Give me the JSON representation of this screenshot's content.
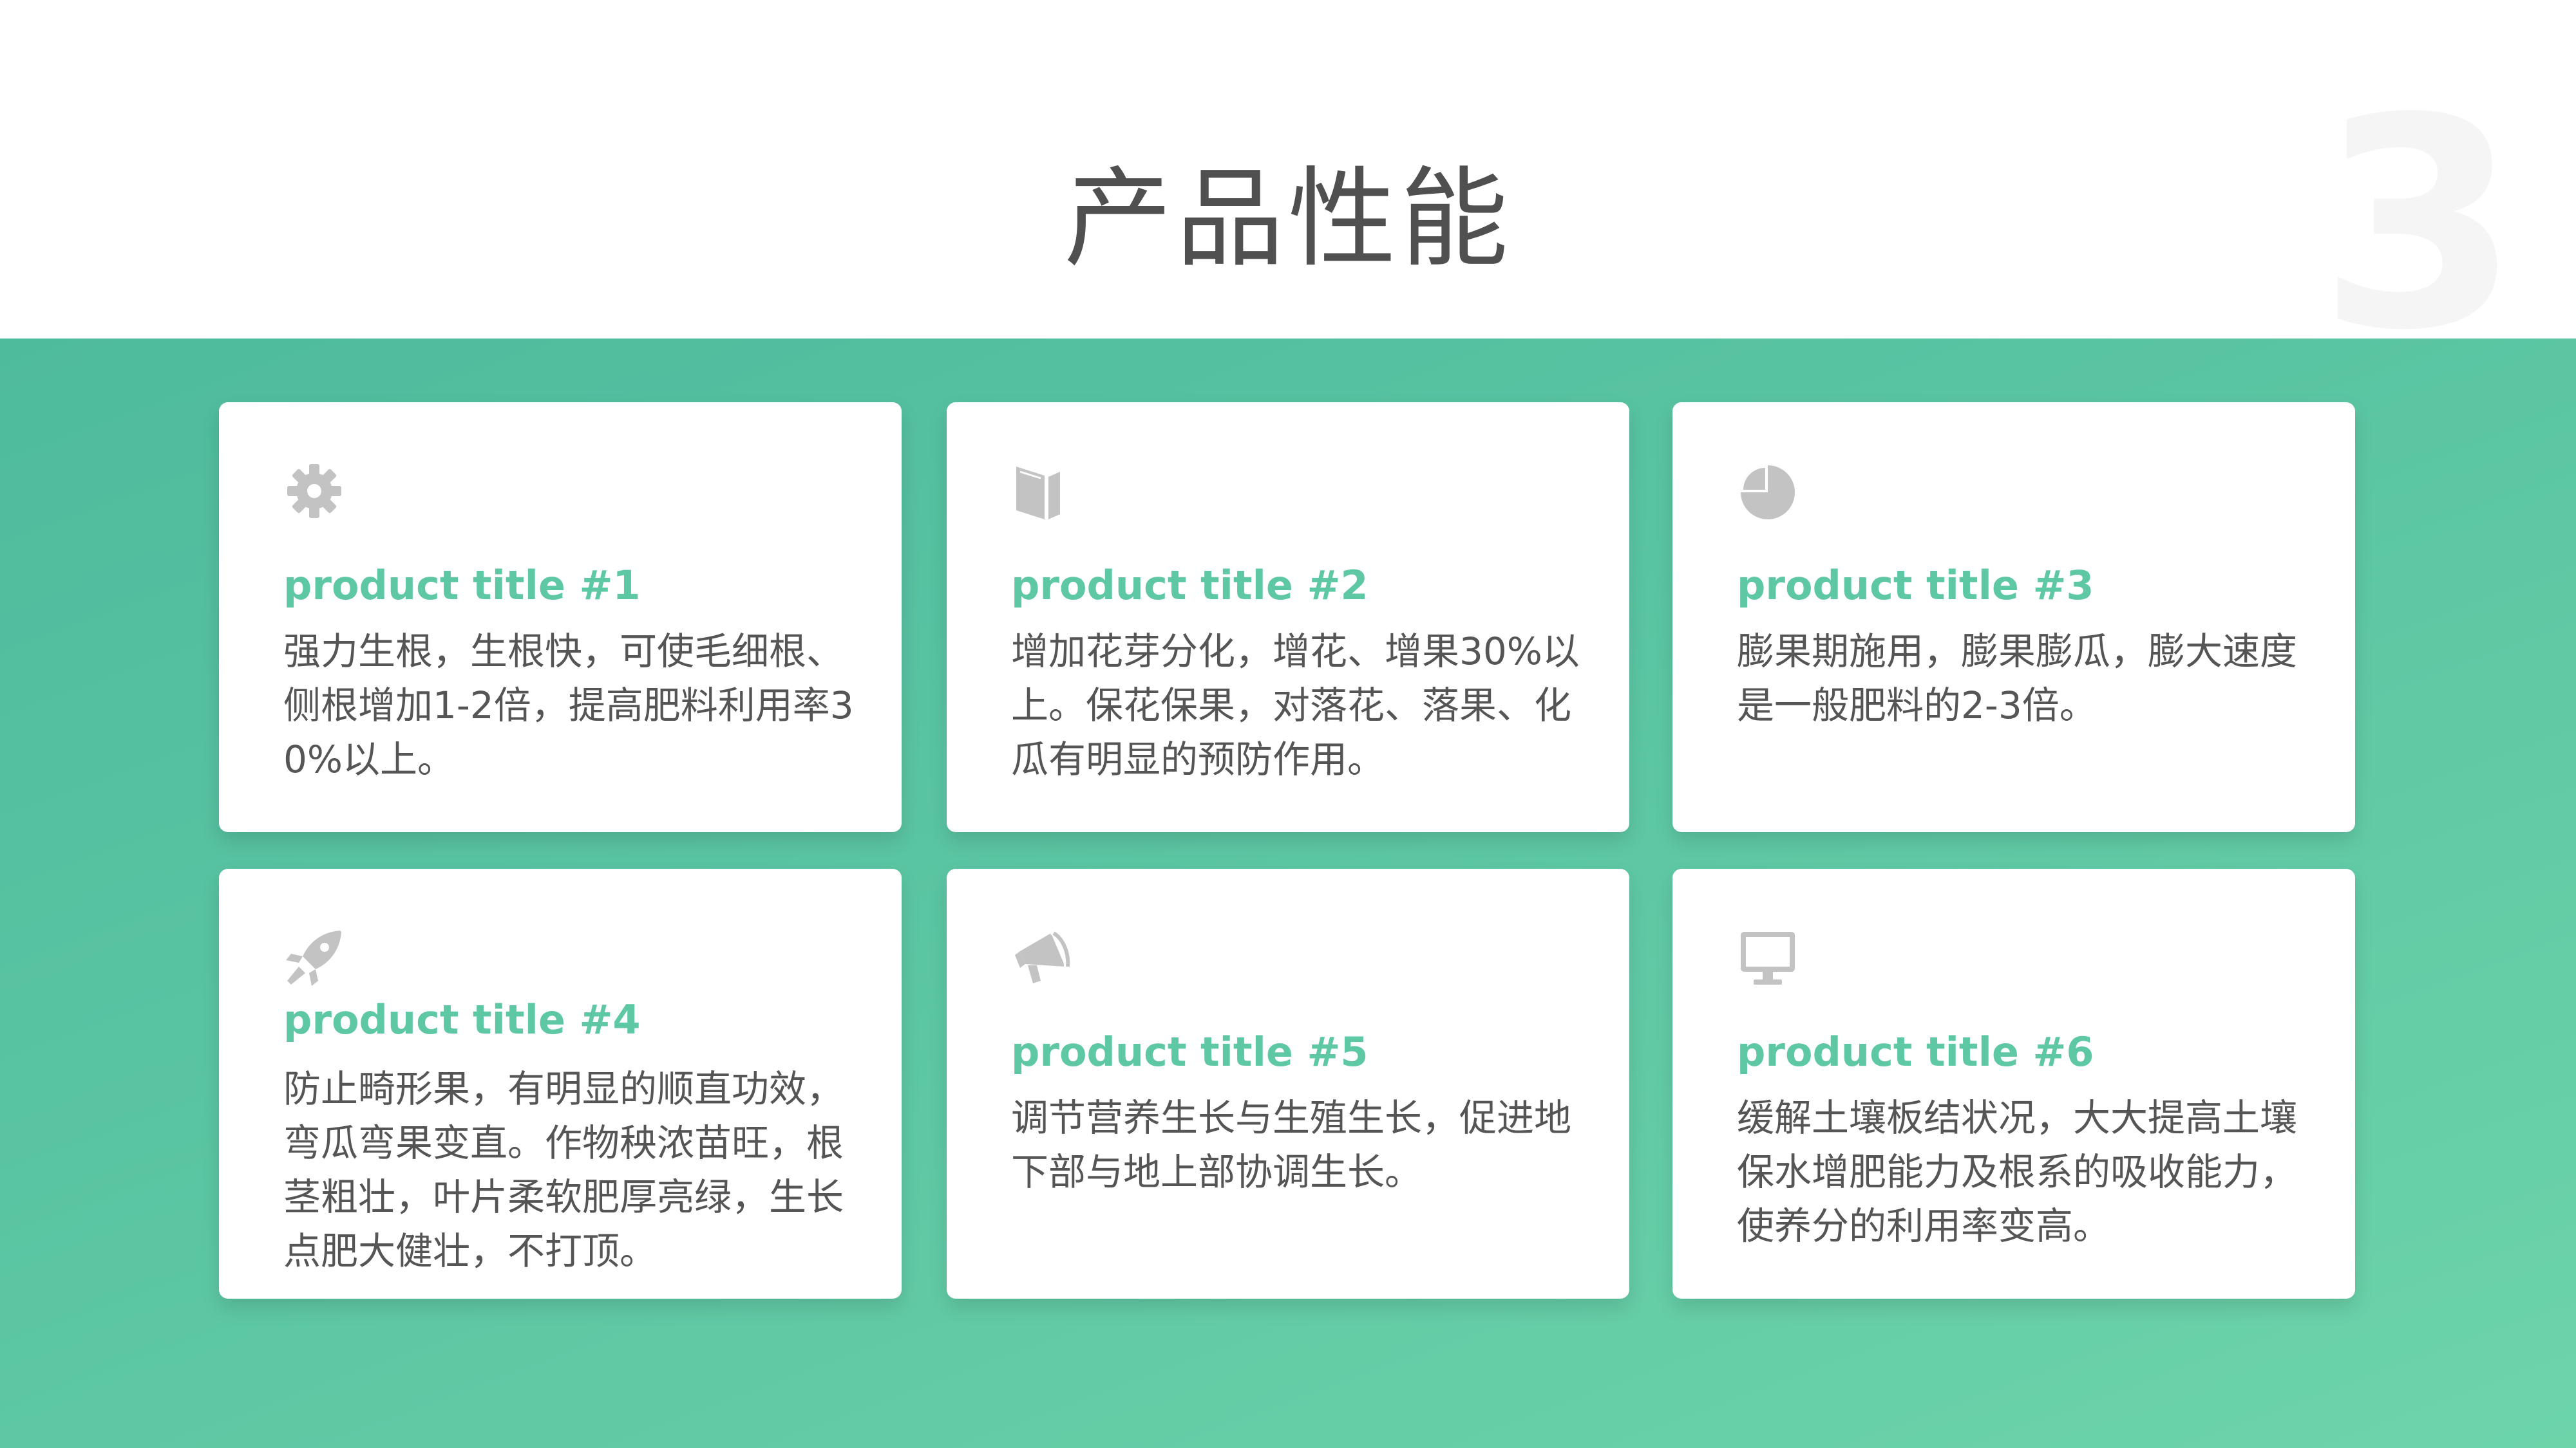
{
  "slide": {
    "title": "产品性能",
    "number": "3"
  },
  "colors": {
    "accent": "#5ec8a4",
    "band_start": "#4fbb9d",
    "band_end": "#6dd4aa",
    "icon": "#c3c3c3",
    "text": "#555555"
  },
  "cards": [
    {
      "icon": "gear-icon",
      "title": "product title #1",
      "desc": "强力生根，生根快，可使毛细根、侧根增加1-2倍，提高肥料利用率30%以上。"
    },
    {
      "icon": "book-icon",
      "title": "product title #2",
      "desc": "增加花芽分化，增花、增果30%以上。保花保果，对落花、落果、化瓜有明显的预防作用。"
    },
    {
      "icon": "pie-chart-icon",
      "title": "product title #3",
      "desc": "膨果期施用，膨果膨瓜，膨大速度是一般肥料的2-3倍。"
    },
    {
      "icon": "rocket-icon",
      "title": "product title #4",
      "desc": "防止畸形果，有明显的顺直功效，弯瓜弯果变直。作物秧浓苗旺，根茎粗壮，叶片柔软肥厚亮绿，生长点肥大健壮，不打顶。"
    },
    {
      "icon": "megaphone-icon",
      "title": "product title #5",
      "desc": "调节营养生长与生殖生长，促进地下部与地上部协调生长。"
    },
    {
      "icon": "monitor-icon",
      "title": "product title #6",
      "desc": "缓解土壤板结状况，大大提高土壤保水增肥能力及根系的吸收能力，使养分的利用率变高。"
    }
  ]
}
